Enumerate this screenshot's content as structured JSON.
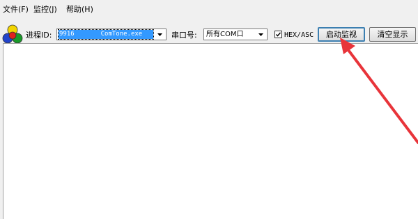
{
  "menu": {
    "file": "文件(F)",
    "monitor": "监控(J)",
    "help": "帮助(H)"
  },
  "toolbar": {
    "process_label": "进程ID:",
    "process_value": "9916       ComTone.exe",
    "port_label": "串口号:",
    "port_value": "所有COM口",
    "hex_asc_label": "HEX/ASC",
    "hex_asc_checked": true,
    "start_button": "启动监视",
    "clear_button": "清空显示"
  },
  "colors": {
    "annotation_arrow": "#e8343a",
    "selection": "#3399ff"
  }
}
